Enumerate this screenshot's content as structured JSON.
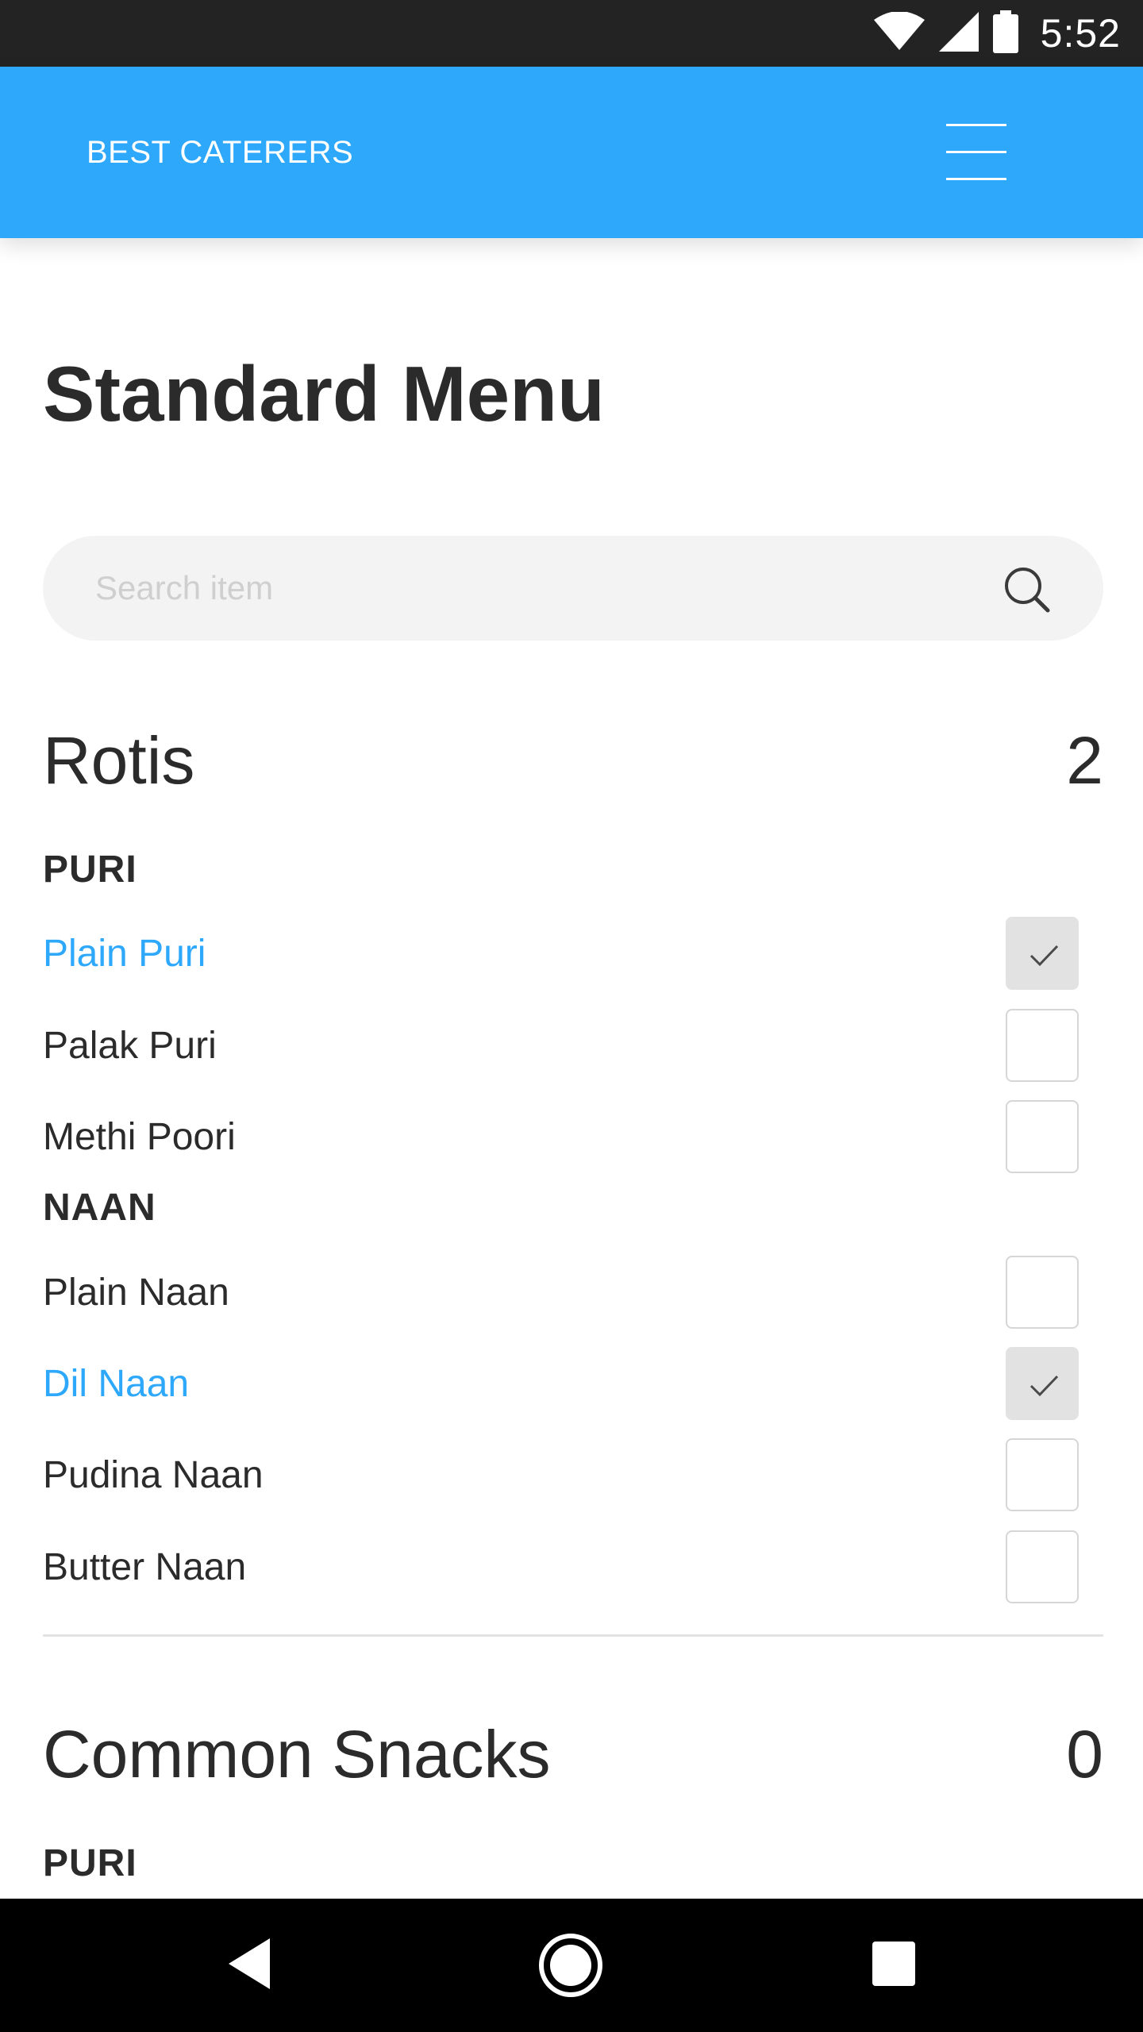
{
  "status_bar": {
    "time": "5:52",
    "icons": [
      "wifi-icon",
      "signal-icon",
      "battery-icon"
    ]
  },
  "app_bar": {
    "brand": "BEST CATERERS",
    "menu_icon": "hamburger-menu-icon",
    "color": "#2ea8fb"
  },
  "page": {
    "title": "Standard Menu"
  },
  "search": {
    "placeholder": "Search item",
    "value": "",
    "icon": "search-icon"
  },
  "sections": [
    {
      "title": "Rotis",
      "count": "2",
      "groups": [
        {
          "label": "PURI",
          "items": [
            {
              "label": "Plain Puri",
              "selected": true
            },
            {
              "label": "Palak Puri",
              "selected": false
            },
            {
              "label": "Methi Poori",
              "selected": false
            }
          ]
        },
        {
          "label": "NAAN",
          "items": [
            {
              "label": "Plain Naan",
              "selected": false
            },
            {
              "label": "Dil Naan",
              "selected": true
            },
            {
              "label": "Pudina Naan",
              "selected": false
            },
            {
              "label": "Butter Naan",
              "selected": false
            }
          ]
        }
      ]
    },
    {
      "title": "Common Snacks",
      "count": "0",
      "groups": [
        {
          "label": "PURI",
          "items": []
        }
      ]
    }
  ],
  "nav_bar": {
    "icons": [
      "back-icon",
      "home-icon",
      "recents-icon"
    ]
  },
  "colors": {
    "accent": "#2ea8fb",
    "text": "#2b2b2b",
    "status_bar": "#232323",
    "nav_bar": "#000000"
  }
}
